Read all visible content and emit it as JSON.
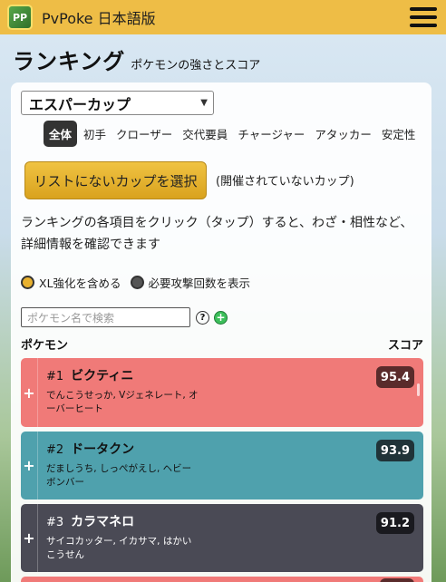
{
  "header": {
    "logo_text": "PP",
    "brand": "PvPoke 日本語版"
  },
  "page": {
    "title": "ランキング",
    "subtitle": "ポケモンの強さとスコア"
  },
  "cup_select": {
    "value": "エスパーカップ"
  },
  "role_tabs": [
    {
      "label": "全体",
      "active": true
    },
    {
      "label": "初手",
      "active": false
    },
    {
      "label": "クローザー",
      "active": false
    },
    {
      "label": "交代要員",
      "active": false
    },
    {
      "label": "チャージャー",
      "active": false
    },
    {
      "label": "アタッカー",
      "active": false
    },
    {
      "label": "安定性",
      "active": false
    }
  ],
  "cup_button": {
    "label": "リストにないカップを選択",
    "note": "(開催されていないカップ)"
  },
  "description": "ランキングの各項目をクリック（タップ）すると、わざ・相性など、詳細情報を確認できます",
  "toggles": {
    "xl_label": "XL強化を含める",
    "moves_label": "必要攻撃回数を表示"
  },
  "search": {
    "placeholder": "ポケモン名で検索"
  },
  "columns": {
    "pokemon": "ポケモン",
    "score": "スコア"
  },
  "rankings": [
    {
      "rank": "#1",
      "name": "ビクティニ",
      "moves": "でんこうせっか, Vジェネレート, オーバーヒート",
      "score": "95.4",
      "bg": "#f07a78",
      "badge": "#5a2b2b",
      "text": "#111111"
    },
    {
      "rank": "#2",
      "name": "ドータクン",
      "moves": "だましうち, しっぺがえし, ヘビーボンバー",
      "score": "93.9",
      "bg": "#4fa1ad",
      "badge": "#203338",
      "text": "#111111"
    },
    {
      "rank": "#3",
      "name": "カラマネロ",
      "moves": "サイコカッター, イカサマ, はかいこうせん",
      "score": "91.2",
      "bg": "#4a4a55",
      "badge": "#1a1a1f",
      "text": "#ffffff"
    },
    {
      "rank": "",
      "name": "",
      "moves": "",
      "score": "",
      "bg": "#f07a78",
      "badge": "#5a2b2b",
      "text": "#111111"
    }
  ]
}
